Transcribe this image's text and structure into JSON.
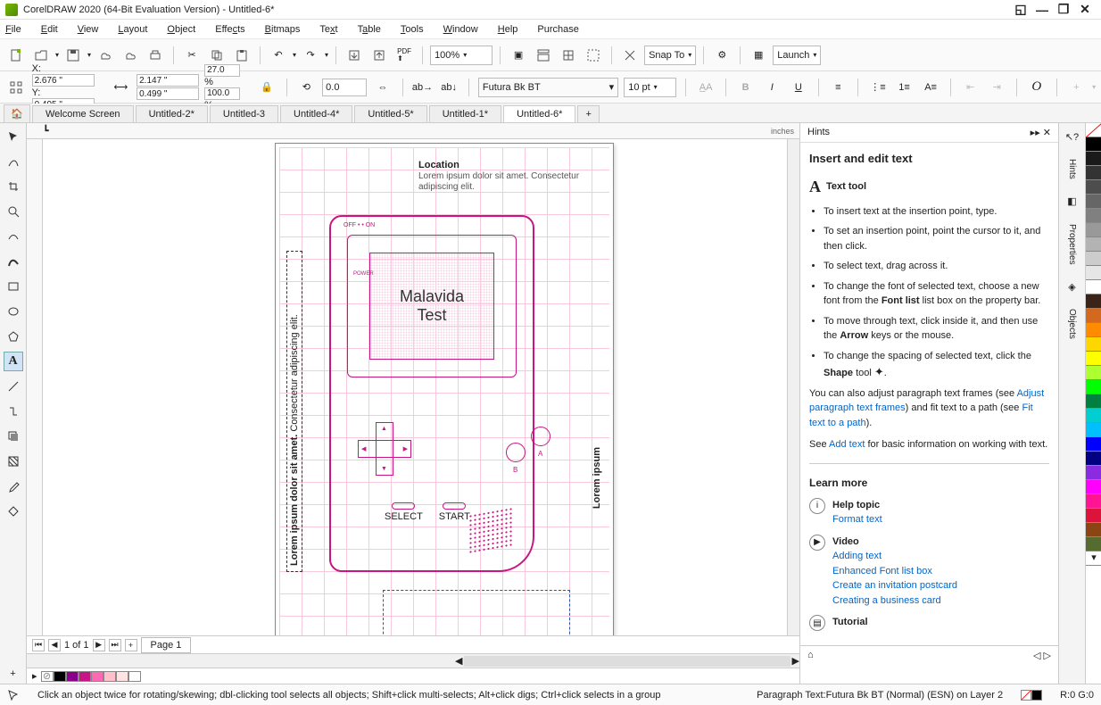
{
  "titlebar": {
    "app": "CorelDRAW 2020 (64-Bit Evaluation Version) - Untitled-6*"
  },
  "menu": [
    "File",
    "Edit",
    "View",
    "Layout",
    "Object",
    "Effects",
    "Bitmaps",
    "Text",
    "Table",
    "Tools",
    "Window",
    "Help",
    "Purchase"
  ],
  "zoom": "100%",
  "snap": "Snap To",
  "launch": "Launch",
  "coords": {
    "x": "2.676 \"",
    "y": "0.495 \"",
    "w": "2.147 \"",
    "h": "0.499 \"",
    "sx": "27.0",
    "sy": "100.0",
    "rot": "0.0"
  },
  "font": {
    "name": "Futura Bk BT",
    "size": "10 pt"
  },
  "tabs": [
    "Welcome Screen",
    "Untitled-2*",
    "Untitled-3",
    "Untitled-4*",
    "Untitled-5*",
    "Untitled-1*",
    "Untitled-6*"
  ],
  "active_tab": 6,
  "ruler_unit": "inches",
  "canvas": {
    "loc_title": "Location",
    "loc_body": "Lorem ipsum dolor sit amet. Consectetur adipiscing elit.",
    "main_text": "Malavida",
    "main_text2": "Test",
    "onoff": "OFF •  • ON",
    "power": "POWER",
    "select": "SELECT",
    "start": "START",
    "a": "A",
    "b": "B",
    "side": "Lorem ipsum dolor sit amet. Consectetur adipiscing elit.",
    "side2": "Lorem ipsum"
  },
  "pager": {
    "pages": "1 of 1",
    "tab": "Page 1"
  },
  "hints": {
    "title": "Hints",
    "h": "Insert and edit text",
    "tool": "Text tool",
    "bullets": [
      "To insert text at the insertion point, type.",
      "To set an insertion point, point the cursor to it, and then click.",
      "To select text, drag across it.",
      "To change the font of selected text, choose a new font from the Font list list box on the property bar.",
      "To move through text, click inside it, and then use the Arrow keys or the mouse.",
      "To change the spacing of selected text, click the Shape tool ."
    ],
    "para1a": "You can also adjust paragraph text frames (see ",
    "link1": "Adjust paragraph text frames",
    "para1b": ") and fit text to a path (see ",
    "link2": "Fit text to a path",
    "para1c": ").",
    "para2a": "See ",
    "link3": "Add text",
    "para2b": " for basic information on working with text.",
    "learn": "Learn more",
    "help": "Help topic",
    "help_link": "Format text",
    "video": "Video",
    "vlinks": [
      "Adding text",
      "Enhanced Font list box",
      "Create an invitation postcard",
      "Creating a business card"
    ],
    "tutorial": "Tutorial"
  },
  "rside_tabs": [
    "Hints",
    "Properties",
    "Objects"
  ],
  "colors": [
    "#ffffff",
    "#000000",
    "#1a1a1a",
    "#333333",
    "#4d4d4d",
    "#666666",
    "#808080",
    "#999999",
    "#b3b3b3",
    "#cccccc",
    "#e6e6e6",
    "#7a4a2a",
    "#d2691e",
    "#ff8c00",
    "#ffd700",
    "#ffff00",
    "#adff2f",
    "#00ff00",
    "#00ced1",
    "#00bfff",
    "#0000ff",
    "#8a2be2",
    "#ff00ff",
    "#ff1493",
    "#dc143c",
    "#8b4513",
    "#556b2f"
  ],
  "status": {
    "hint": "Click an object twice for rotating/skewing; dbl-clicking tool selects all objects; Shift+click multi-selects; Alt+click digs; Ctrl+click selects in a group",
    "obj": "Paragraph Text:Futura Bk BT (Normal) (ESN) on Layer 2",
    "rgb": "R:0 G:0"
  },
  "palette": [
    "#ffffff",
    "#000000",
    "#8b008b",
    "#c71585",
    "#ff69b4",
    "#ffc0cb",
    "#ffe4e1",
    "#ffffff"
  ]
}
